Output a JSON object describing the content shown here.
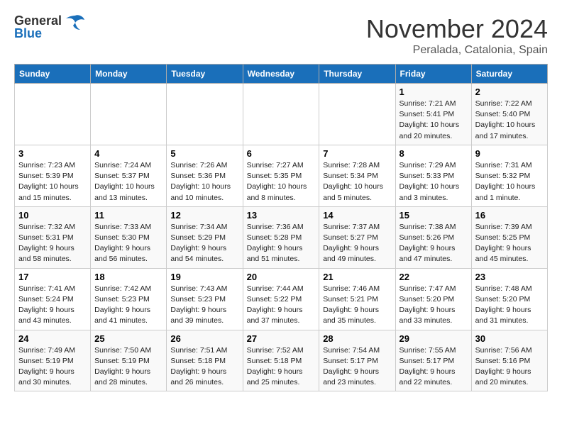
{
  "header": {
    "logo_general": "General",
    "logo_blue": "Blue",
    "month_title": "November 2024",
    "location": "Peralada, Catalonia, Spain"
  },
  "columns": [
    "Sunday",
    "Monday",
    "Tuesday",
    "Wednesday",
    "Thursday",
    "Friday",
    "Saturday"
  ],
  "weeks": [
    {
      "cells": [
        {
          "day": "",
          "info": ""
        },
        {
          "day": "",
          "info": ""
        },
        {
          "day": "",
          "info": ""
        },
        {
          "day": "",
          "info": ""
        },
        {
          "day": "",
          "info": ""
        },
        {
          "day": "1",
          "info": "Sunrise: 7:21 AM\nSunset: 5:41 PM\nDaylight: 10 hours\nand 20 minutes."
        },
        {
          "day": "2",
          "info": "Sunrise: 7:22 AM\nSunset: 5:40 PM\nDaylight: 10 hours\nand 17 minutes."
        }
      ]
    },
    {
      "cells": [
        {
          "day": "3",
          "info": "Sunrise: 7:23 AM\nSunset: 5:39 PM\nDaylight: 10 hours\nand 15 minutes."
        },
        {
          "day": "4",
          "info": "Sunrise: 7:24 AM\nSunset: 5:37 PM\nDaylight: 10 hours\nand 13 minutes."
        },
        {
          "day": "5",
          "info": "Sunrise: 7:26 AM\nSunset: 5:36 PM\nDaylight: 10 hours\nand 10 minutes."
        },
        {
          "day": "6",
          "info": "Sunrise: 7:27 AM\nSunset: 5:35 PM\nDaylight: 10 hours\nand 8 minutes."
        },
        {
          "day": "7",
          "info": "Sunrise: 7:28 AM\nSunset: 5:34 PM\nDaylight: 10 hours\nand 5 minutes."
        },
        {
          "day": "8",
          "info": "Sunrise: 7:29 AM\nSunset: 5:33 PM\nDaylight: 10 hours\nand 3 minutes."
        },
        {
          "day": "9",
          "info": "Sunrise: 7:31 AM\nSunset: 5:32 PM\nDaylight: 10 hours\nand 1 minute."
        }
      ]
    },
    {
      "cells": [
        {
          "day": "10",
          "info": "Sunrise: 7:32 AM\nSunset: 5:31 PM\nDaylight: 9 hours\nand 58 minutes."
        },
        {
          "day": "11",
          "info": "Sunrise: 7:33 AM\nSunset: 5:30 PM\nDaylight: 9 hours\nand 56 minutes."
        },
        {
          "day": "12",
          "info": "Sunrise: 7:34 AM\nSunset: 5:29 PM\nDaylight: 9 hours\nand 54 minutes."
        },
        {
          "day": "13",
          "info": "Sunrise: 7:36 AM\nSunset: 5:28 PM\nDaylight: 9 hours\nand 51 minutes."
        },
        {
          "day": "14",
          "info": "Sunrise: 7:37 AM\nSunset: 5:27 PM\nDaylight: 9 hours\nand 49 minutes."
        },
        {
          "day": "15",
          "info": "Sunrise: 7:38 AM\nSunset: 5:26 PM\nDaylight: 9 hours\nand 47 minutes."
        },
        {
          "day": "16",
          "info": "Sunrise: 7:39 AM\nSunset: 5:25 PM\nDaylight: 9 hours\nand 45 minutes."
        }
      ]
    },
    {
      "cells": [
        {
          "day": "17",
          "info": "Sunrise: 7:41 AM\nSunset: 5:24 PM\nDaylight: 9 hours\nand 43 minutes."
        },
        {
          "day": "18",
          "info": "Sunrise: 7:42 AM\nSunset: 5:23 PM\nDaylight: 9 hours\nand 41 minutes."
        },
        {
          "day": "19",
          "info": "Sunrise: 7:43 AM\nSunset: 5:23 PM\nDaylight: 9 hours\nand 39 minutes."
        },
        {
          "day": "20",
          "info": "Sunrise: 7:44 AM\nSunset: 5:22 PM\nDaylight: 9 hours\nand 37 minutes."
        },
        {
          "day": "21",
          "info": "Sunrise: 7:46 AM\nSunset: 5:21 PM\nDaylight: 9 hours\nand 35 minutes."
        },
        {
          "day": "22",
          "info": "Sunrise: 7:47 AM\nSunset: 5:20 PM\nDaylight: 9 hours\nand 33 minutes."
        },
        {
          "day": "23",
          "info": "Sunrise: 7:48 AM\nSunset: 5:20 PM\nDaylight: 9 hours\nand 31 minutes."
        }
      ]
    },
    {
      "cells": [
        {
          "day": "24",
          "info": "Sunrise: 7:49 AM\nSunset: 5:19 PM\nDaylight: 9 hours\nand 30 minutes."
        },
        {
          "day": "25",
          "info": "Sunrise: 7:50 AM\nSunset: 5:19 PM\nDaylight: 9 hours\nand 28 minutes."
        },
        {
          "day": "26",
          "info": "Sunrise: 7:51 AM\nSunset: 5:18 PM\nDaylight: 9 hours\nand 26 minutes."
        },
        {
          "day": "27",
          "info": "Sunrise: 7:52 AM\nSunset: 5:18 PM\nDaylight: 9 hours\nand 25 minutes."
        },
        {
          "day": "28",
          "info": "Sunrise: 7:54 AM\nSunset: 5:17 PM\nDaylight: 9 hours\nand 23 minutes."
        },
        {
          "day": "29",
          "info": "Sunrise: 7:55 AM\nSunset: 5:17 PM\nDaylight: 9 hours\nand 22 minutes."
        },
        {
          "day": "30",
          "info": "Sunrise: 7:56 AM\nSunset: 5:16 PM\nDaylight: 9 hours\nand 20 minutes."
        }
      ]
    }
  ]
}
